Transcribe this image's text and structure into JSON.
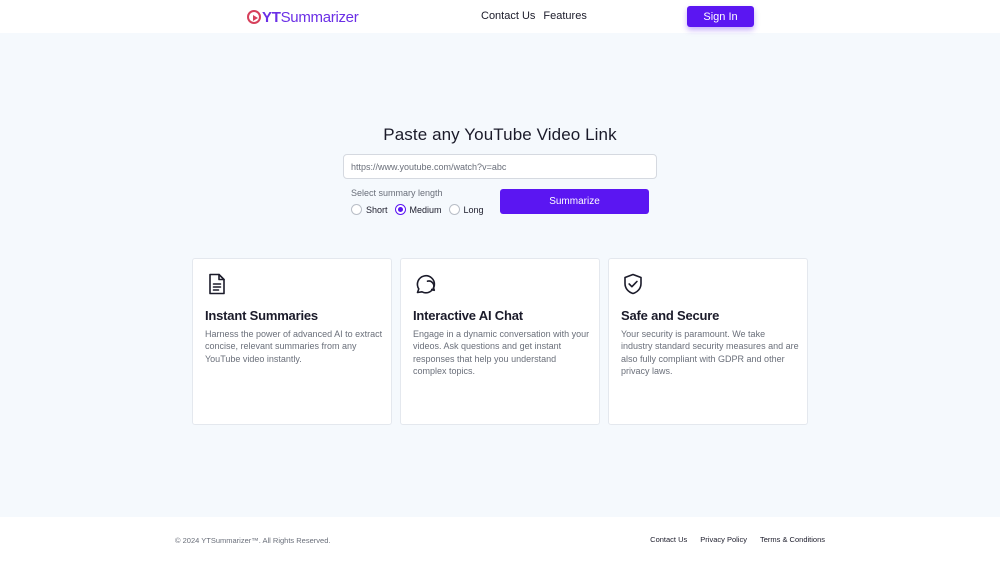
{
  "header": {
    "logo_bold": "YT",
    "logo_rest": "Summarizer",
    "nav": [
      "Contact Us",
      "Features"
    ],
    "signin_label": "Sign In"
  },
  "hero": {
    "title": "Paste any YouTube Video Link",
    "url_placeholder": "https://www.youtube.com/watch?v=abc",
    "length_label": "Select summary length",
    "options": [
      "Short",
      "Medium",
      "Long"
    ],
    "selected_option": "Medium",
    "summarize_label": "Summarize"
  },
  "features": [
    {
      "icon": "document-icon",
      "title": "Instant Summaries",
      "text": "Harness the power of advanced AI to extract concise, relevant summaries from any YouTube video instantly."
    },
    {
      "icon": "chat-bubble-icon",
      "title": "Interactive AI Chat",
      "text": "Engage in a dynamic conversation with your videos. Ask questions and get instant responses that help you understand complex topics."
    },
    {
      "icon": "shield-check-icon",
      "title": "Safe and Secure",
      "text": "Your security is paramount. We take industry standard security measures and are also fully compliant with GDPR and other privacy laws."
    }
  ],
  "footer": {
    "copyright": "© 2024 YTSummarizer™. All Rights Reserved.",
    "links": [
      "Contact Us",
      "Privacy Policy",
      "Terms & Conditions"
    ]
  },
  "colors": {
    "primary": "#5b16f2",
    "logo_red": "#d6405b",
    "page_bg": "#f5f9fd"
  }
}
